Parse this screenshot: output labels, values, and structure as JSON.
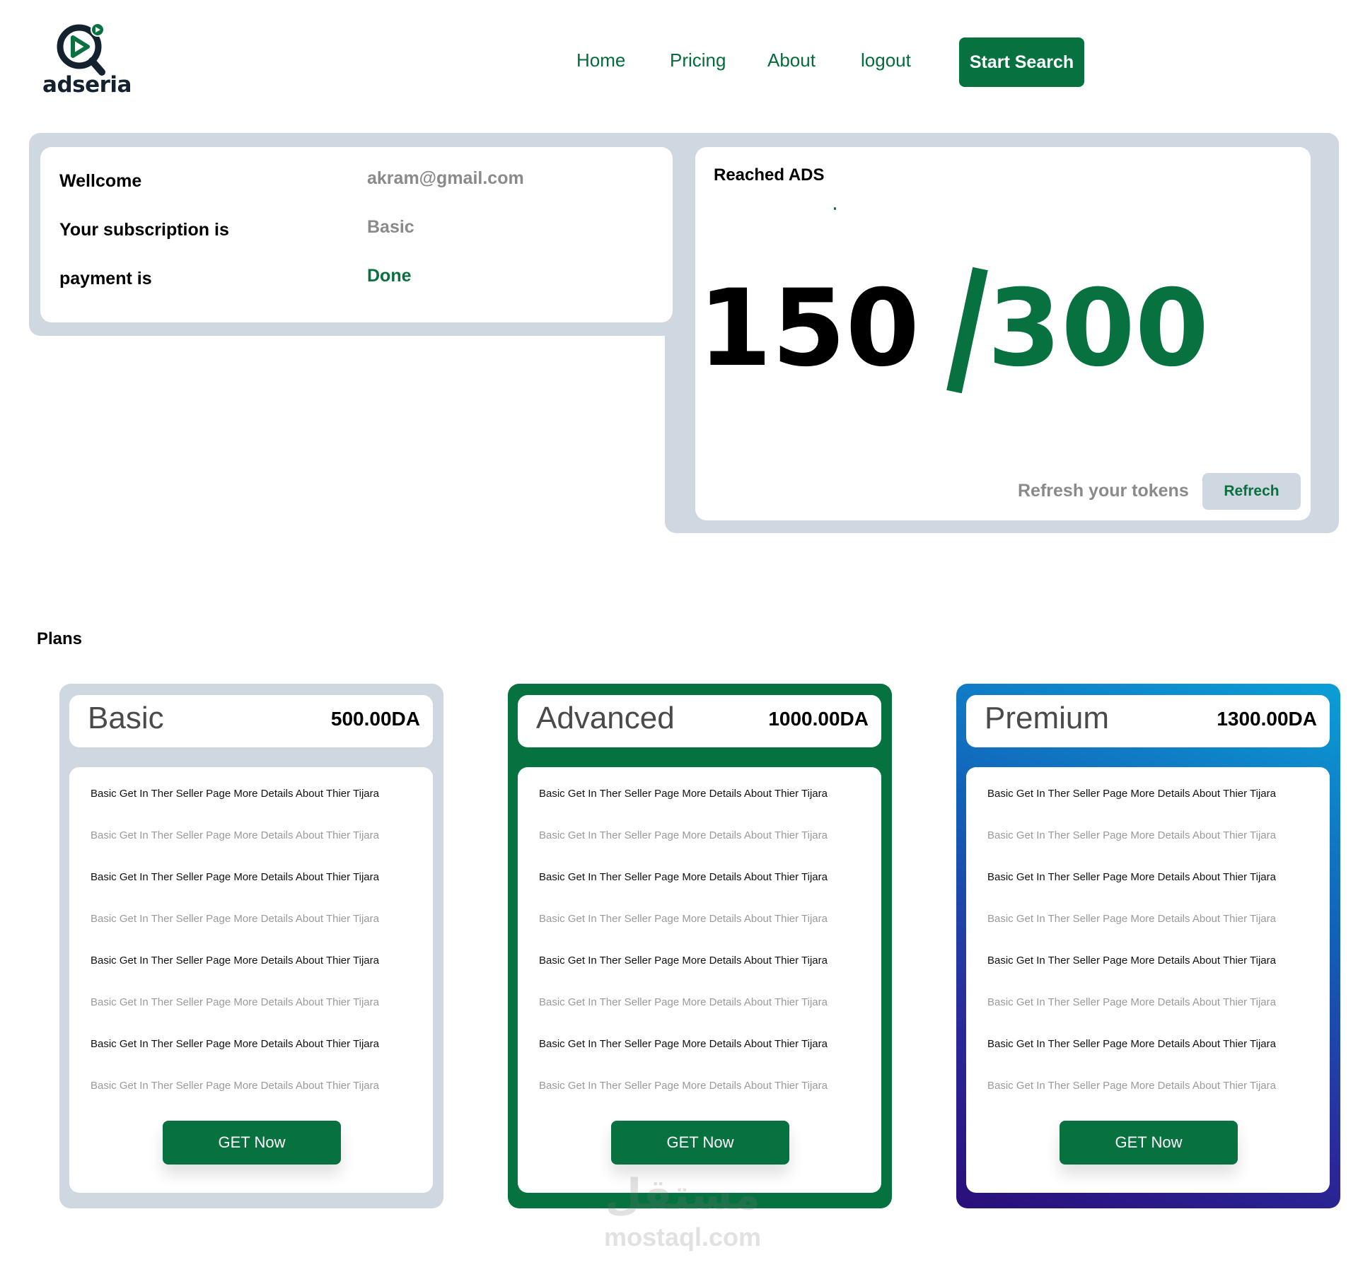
{
  "brand": {
    "name": "adseria",
    "dark_color": "#14212e",
    "accent_color": "#07723f"
  },
  "nav": {
    "links": [
      "Home",
      "Pricing",
      "About",
      "logout"
    ],
    "cta_label": "Start Search"
  },
  "account": {
    "rows": [
      {
        "label": "Wellcome",
        "value": "akram@gmail.com",
        "status": ""
      },
      {
        "label": "Your subscription is",
        "value": "Basic",
        "status": ""
      },
      {
        "label": "payment is",
        "value": "Done",
        "status": "success"
      }
    ]
  },
  "ads": {
    "title": "Reached ADS",
    "reached": "150",
    "separator": "/",
    "total": "300",
    "refresh_label": "Refresh your tokens",
    "refresh_button": "Refrech"
  },
  "plans": {
    "title": "Plans",
    "items": [
      {
        "name": "Basic",
        "price": "500.00DA",
        "button_label": "GET Now",
        "features": [
          "Basic  Get In Ther Seller Page More Details About Thier Tijara",
          "Basic  Get In Ther Seller Page More Details About Thier Tijara",
          "Basic  Get In Ther Seller Page More Details About Thier Tijara",
          "Basic  Get In Ther Seller Page More Details About Thier Tijara",
          "Basic  Get In Ther Seller Page More Details About Thier Tijara",
          "Basic  Get In Ther Seller Page More Details About Thier Tijara",
          "Basic  Get In Ther Seller Page More Details About Thier Tijara",
          "Basic  Get In Ther Seller Page More Details About Thier Tijara"
        ]
      },
      {
        "name": "Advanced",
        "price": "1000.00DA",
        "button_label": "GET Now",
        "features": [
          "Basic  Get In Ther Seller Page More Details About Thier Tijara",
          "Basic  Get In Ther Seller Page More Details About Thier Tijara",
          "Basic  Get In Ther Seller Page More Details About Thier Tijara",
          "Basic  Get In Ther Seller Page More Details About Thier Tijara",
          "Basic  Get In Ther Seller Page More Details About Thier Tijara",
          "Basic  Get In Ther Seller Page More Details About Thier Tijara",
          "Basic  Get In Ther Seller Page More Details About Thier Tijara",
          "Basic  Get In Ther Seller Page More Details About Thier Tijara"
        ]
      },
      {
        "name": "Premium",
        "price": "1300.00DA",
        "button_label": "GET Now",
        "features": [
          "Basic  Get In Ther Seller Page More Details About Thier Tijara",
          "Basic  Get In Ther Seller Page More Details About Thier Tijara",
          "Basic  Get In Ther Seller Page More Details About Thier Tijara",
          "Basic  Get In Ther Seller Page More Details About Thier Tijara",
          "Basic  Get In Ther Seller Page More Details About Thier Tijara",
          "Basic  Get In Ther Seller Page More Details About Thier Tijara",
          "Basic  Get In Ther Seller Page More Details About Thier Tijara",
          "Basic  Get In Ther Seller Page More Details About Thier Tijara"
        ]
      }
    ]
  },
  "watermark": {
    "arabic": "مستقل",
    "latin": "mostaql.com"
  }
}
